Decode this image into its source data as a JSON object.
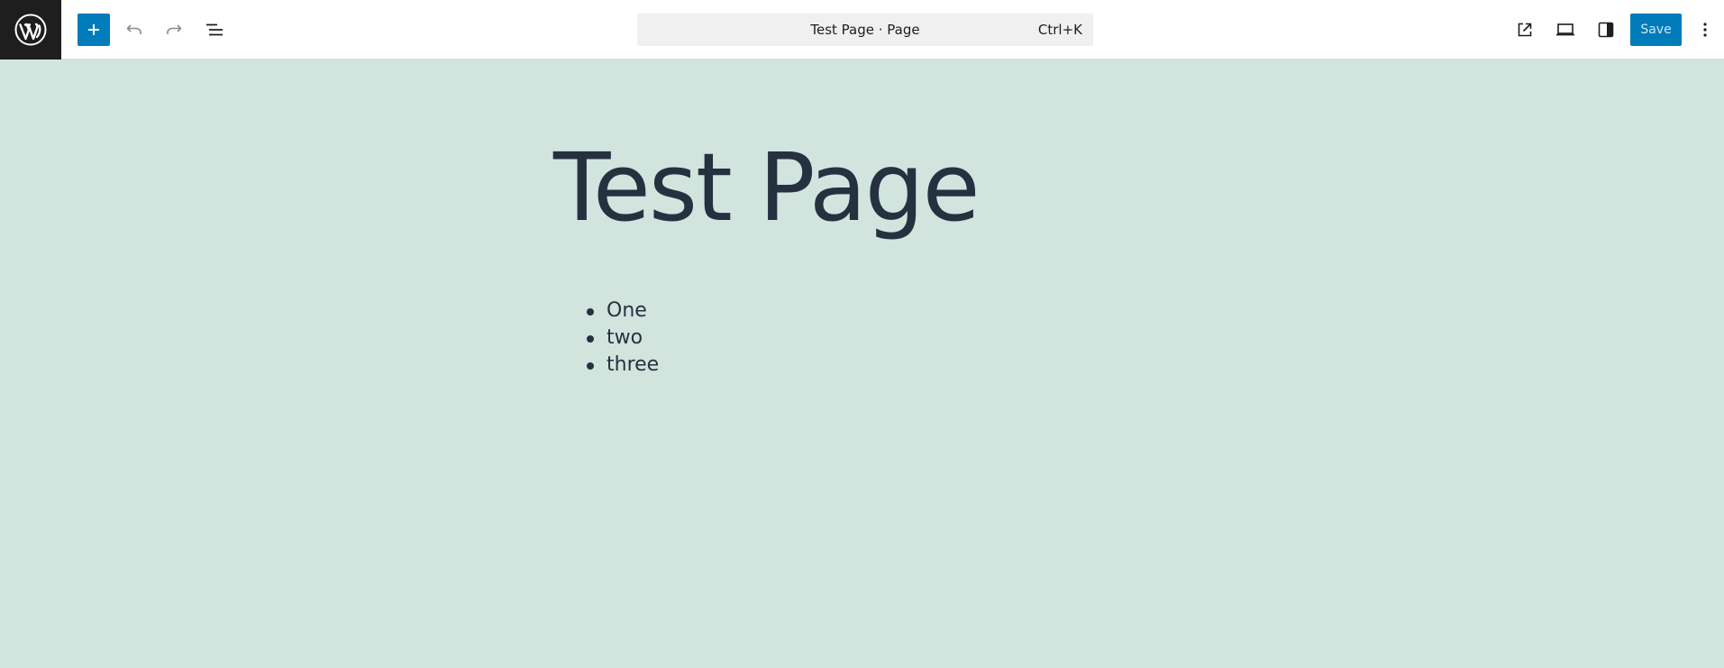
{
  "toolbar": {
    "logo_icon": "wordpress-icon",
    "add_icon": "plus-icon",
    "undo_icon": "undo-icon",
    "redo_icon": "redo-icon",
    "list_view_icon": "list-view-icon",
    "command_title": "Test Page · Page",
    "command_shortcut": "Ctrl+K",
    "view_page_icon": "external-link-icon",
    "device_icon": "desktop-icon",
    "settings_icon": "sidebar-icon",
    "save_label": "Save",
    "options_icon": "more-vertical-icon",
    "accent_color": "#007cba"
  },
  "canvas": {
    "background_color": "#d1e4de",
    "title": "Test Page",
    "list": [
      "One",
      "two",
      "three"
    ]
  }
}
